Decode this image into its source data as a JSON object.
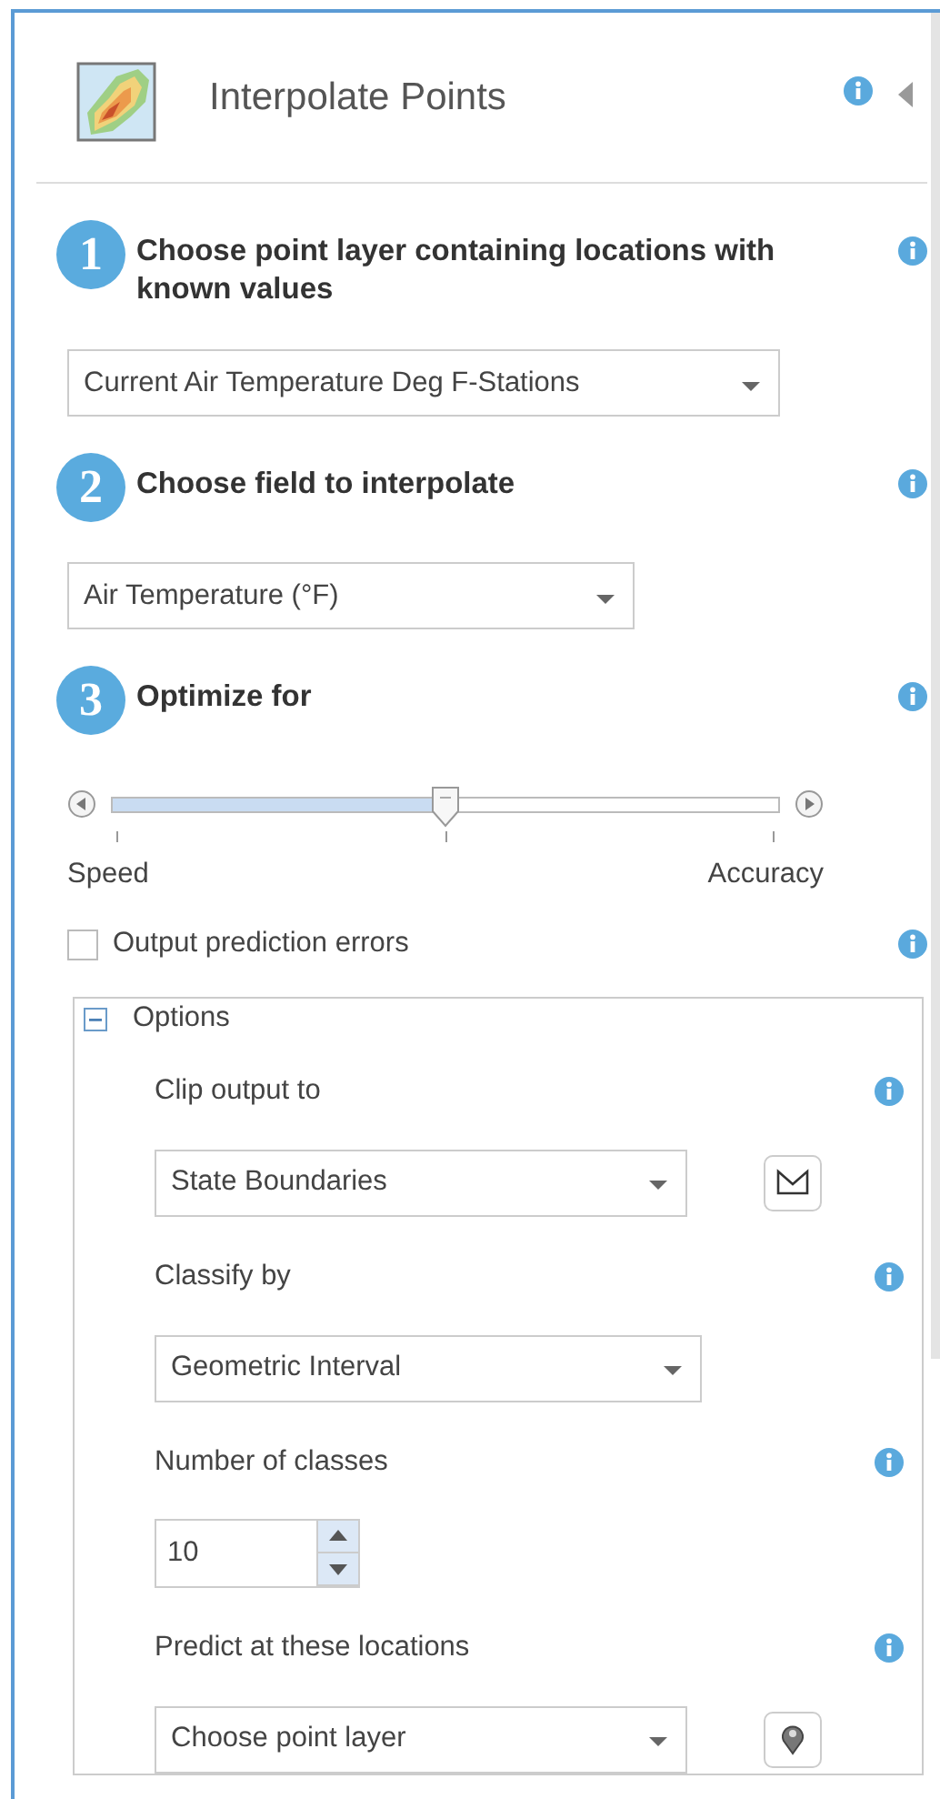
{
  "panel": {
    "title": "Interpolate Points"
  },
  "steps": [
    {
      "number": "1",
      "title": "Choose point layer containing locations with known values",
      "kind": "dropdown",
      "value": "Current Air Temperature Deg F-Stations"
    },
    {
      "number": "2",
      "title": "Choose field to interpolate",
      "kind": "dropdown",
      "value": "Air Temperature (°F)"
    },
    {
      "number": "3",
      "title": "Optimize for",
      "kind": "slider",
      "level": 0.5,
      "min_label": "Speed",
      "max_label": "Accuracy"
    }
  ],
  "output_prediction_errors": {
    "label": "Output prediction errors",
    "checked": false
  },
  "options": {
    "label": "Options",
    "expanded": true,
    "fields": [
      {
        "kind": "area-layer",
        "label": "Clip output to",
        "value": "State Boundaries"
      },
      {
        "kind": "dropdown",
        "label": "Classify by",
        "value": "Geometric Interval"
      },
      {
        "kind": "number",
        "label": "Number of classes",
        "value": "10"
      },
      {
        "kind": "point-layer",
        "label": "Predict at these locations",
        "value": "Choose point layer"
      }
    ]
  }
}
